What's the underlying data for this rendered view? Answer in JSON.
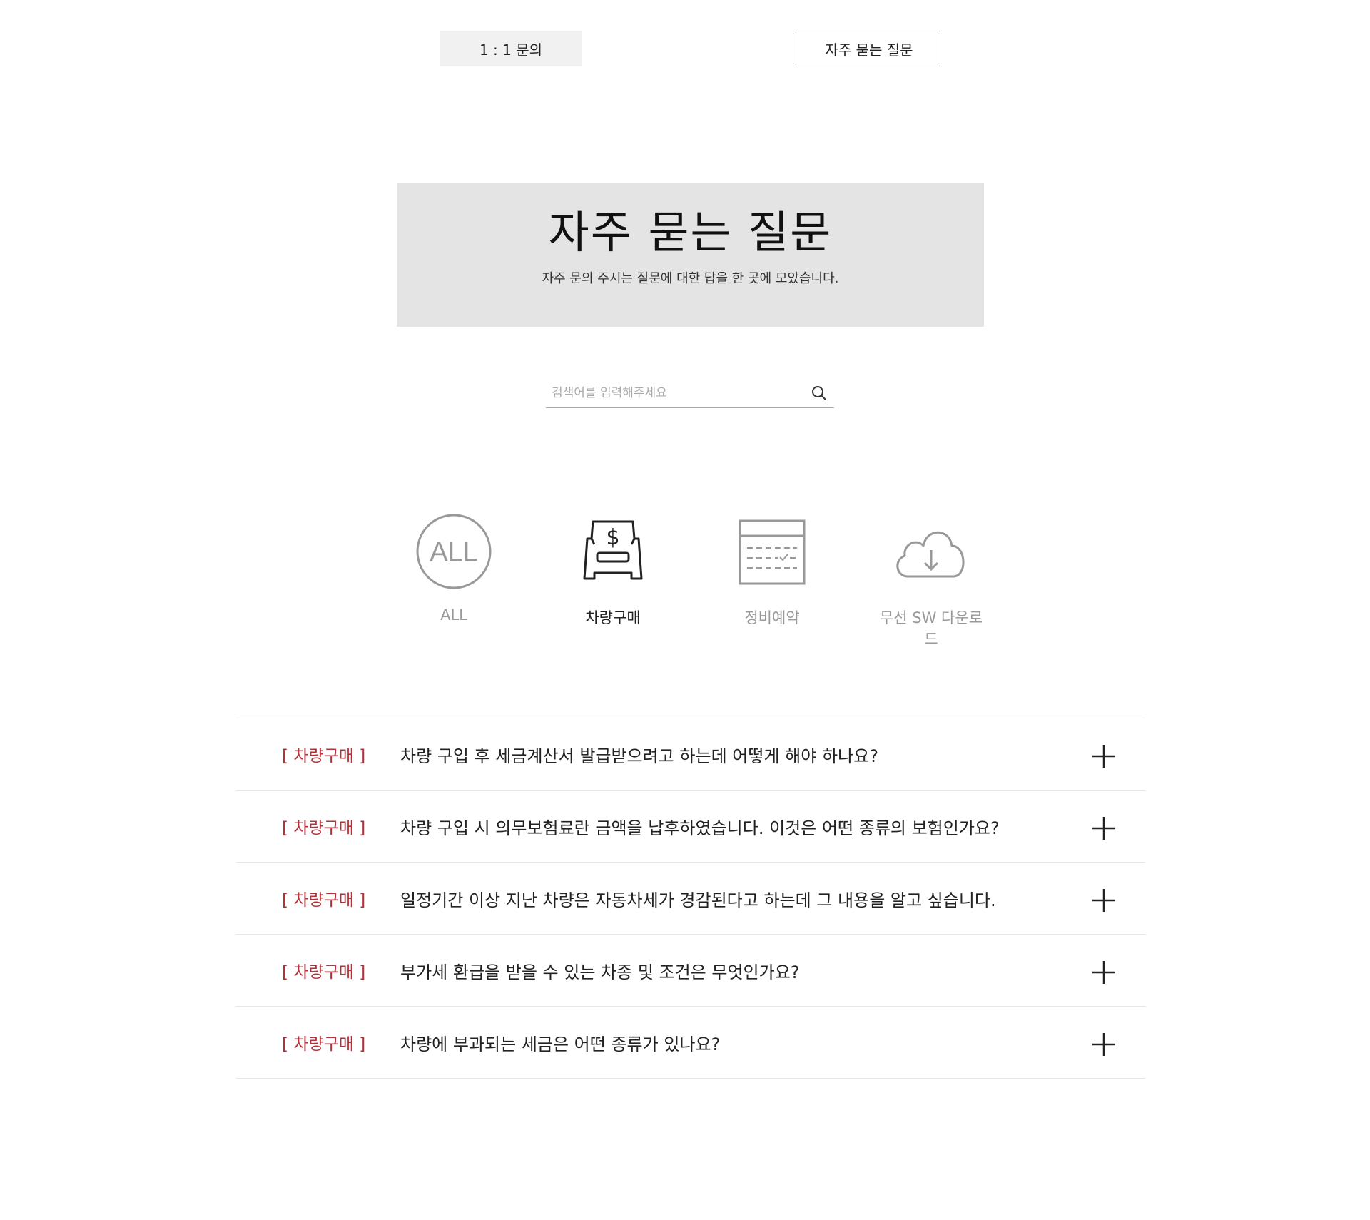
{
  "tabs": {
    "inquiry_label": "1 : 1 문의",
    "faq_label": "자주 묻는 질문"
  },
  "hero": {
    "title": "자주 묻는 질문",
    "subtitle": "자주 문의 주시는 질문에 대한 답을 한 곳에 모았습니다."
  },
  "search": {
    "placeholder": "검색어를 입력해주세요",
    "value": "",
    "icon": "search-icon"
  },
  "categories": [
    {
      "label": "ALL",
      "icon_text": "ALL",
      "icon": "all-circle-icon",
      "selected": false
    },
    {
      "label": "차량구매",
      "icon": "car-dollar-icon",
      "selected": true
    },
    {
      "label": "정비예약",
      "icon": "calendar-icon",
      "selected": false
    },
    {
      "label": "무선 SW 다운로드",
      "icon": "cloud-download-icon",
      "selected": false
    }
  ],
  "faqs": [
    {
      "tag": "[ 차량구매 ]",
      "question": "차량 구입 후 세금계산서 발급받으려고 하는데 어떻게 해야 하나요?"
    },
    {
      "tag": "[ 차량구매 ]",
      "question": "차량 구입 시 의무보험료란 금액을 납후하였습니다. 이것은 어떤 종류의 보험인가요?"
    },
    {
      "tag": "[ 차량구매 ]",
      "question": "일정기간 이상 지난 차량은 자동차세가 경감된다고 하는데 그 내용을 알고 싶습니다."
    },
    {
      "tag": "[ 차량구매 ]",
      "question": "부가세 환급을 받을 수 있는 차종 및 조건은 무엇인가요?"
    },
    {
      "tag": "[ 차량구매 ]",
      "question": "차량에 부과되는 세금은 어떤 종류가 있나요?"
    }
  ],
  "colors": {
    "accent_tag": "#b5313a",
    "hero_bg": "#e4e4e4",
    "inactive_tab_bg": "#f1f1f1",
    "muted_icon": "#999999"
  }
}
